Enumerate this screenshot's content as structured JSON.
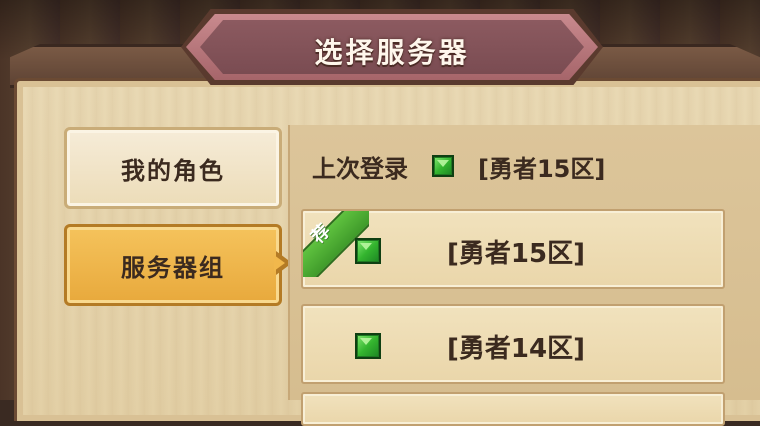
{
  "title": "选择服务器",
  "tabs": [
    {
      "label": "我的角色",
      "selected": false
    },
    {
      "label": "服务器组",
      "selected": true
    }
  ],
  "last_login": {
    "label": "上次登录",
    "server": "[勇者15区]"
  },
  "servers": [
    {
      "name": "[勇者15区]",
      "badge": "荐"
    },
    {
      "name": "[勇者14区]"
    }
  ],
  "colors": {
    "title_banner": "#a6656a",
    "selected_tab": "#f1b84c",
    "recommend_badge": "#4fae33",
    "status_gem": "#34b52f"
  },
  "icons": {
    "status": "green-gem-icon",
    "badge": "recommend-ribbon-icon"
  }
}
